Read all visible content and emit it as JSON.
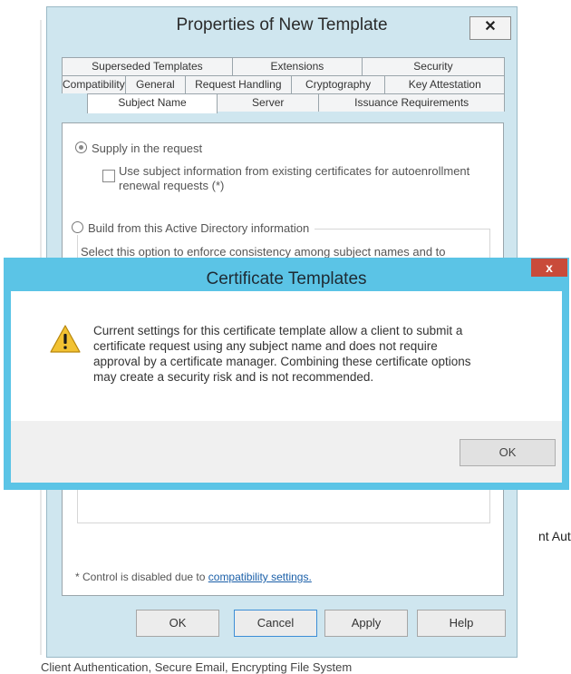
{
  "background": {
    "right_fragment": "nt Authe",
    "bottom_fragment": "Client Authentication, Secure Email, Encrypting File System"
  },
  "properties": {
    "title": "Properties of New Template",
    "close": "✕",
    "tabs_row1": [
      "Superseded Templates",
      "Extensions",
      "Security"
    ],
    "tabs_row2": [
      "Compatibility",
      "General",
      "Request Handling",
      "Cryptography",
      "Key Attestation"
    ],
    "tabs_row3": [
      "Subject Name",
      "Server",
      "Issuance Requirements"
    ],
    "supply_label": "Supply in the request",
    "use_subject_label_1": "Use subject information from existing certificates for autoenrollment",
    "use_subject_label_2": "renewal requests (*)",
    "build_label": "Build from this Active Directory information",
    "select_option_text": "Select this option to enforce consistency among subject names and to",
    "footnote_prefix": "* Control is disabled due to ",
    "footnote_link": "compatibility settings.",
    "buttons": {
      "ok": "OK",
      "cancel": "Cancel",
      "apply": "Apply",
      "help": "Help"
    }
  },
  "dialog": {
    "title": "Certificate Templates",
    "close": "x",
    "message_lines": [
      "Current settings for this certificate template allow a client to submit a",
      "certificate request using any subject name and does not require",
      "approval by a certificate manager. Combining these certificate options",
      "may create a security risk and is not recommended."
    ],
    "ok": "OK",
    "icon": "warning-icon",
    "colors": {
      "titlebar": "#5bc4e6",
      "close": "#c94b3a",
      "warning": "#f2c232"
    }
  }
}
